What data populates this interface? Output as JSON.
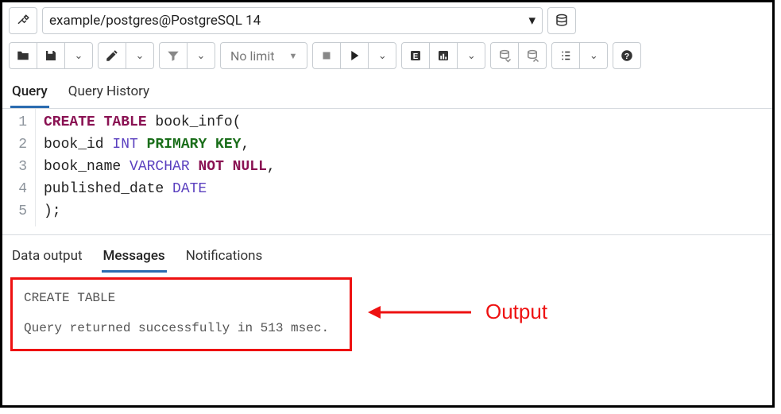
{
  "connection": {
    "label": "example/postgres@PostgreSQL 14"
  },
  "toolbar": {
    "nolimit": "No limit"
  },
  "editorTabs": {
    "query": "Query",
    "history": "Query History"
  },
  "code": {
    "lines": [
      "1",
      "2",
      "3",
      "4",
      "5"
    ],
    "l1a": "CREATE TABLE",
    "l1b": " book_info(",
    "l2a": "book_id ",
    "l2b": "INT",
    "l2c": " ",
    "l2d": "PRIMARY KEY",
    "l2e": ",",
    "l3a": "book_name ",
    "l3b": "VARCHAR",
    "l3c": " ",
    "l3d": "NOT NULL",
    "l3e": ",",
    "l4a": "published_date ",
    "l4b": "DATE",
    "l5": ");"
  },
  "outputTabs": {
    "data": "Data output",
    "messages": "Messages",
    "notifications": "Notifications"
  },
  "messages": {
    "line1": "CREATE TABLE",
    "line2": "Query returned successfully in 513 msec."
  },
  "annotation": {
    "label": "Output"
  }
}
